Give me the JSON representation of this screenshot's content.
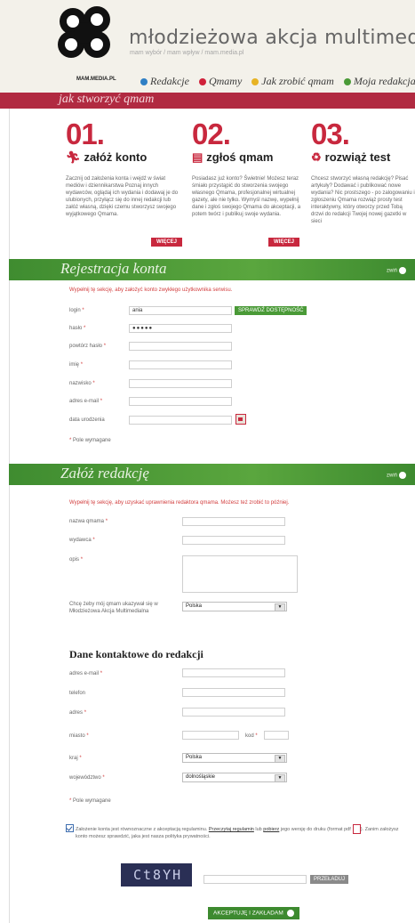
{
  "header": {
    "brand_small": "MAM.MEDIA.PL",
    "site_title": "młodzieżowa akcja multimedialna",
    "tagline": "mam wybór / mam wpływ / mam.media.pl",
    "nav": [
      {
        "label": "Redakcje",
        "color": "#2f7fc5"
      },
      {
        "label": "Qmamy",
        "color": "#d0213a"
      },
      {
        "label": "Jak zrobić qmam",
        "color": "#e7b324"
      },
      {
        "label": "Moja redakcja",
        "color": "#4a9a37"
      }
    ]
  },
  "section_title": "jak stworzyć qmam",
  "steps": [
    {
      "num": "01.",
      "title": "załóż konto",
      "icon": "runner-icon",
      "text": "Zacznij od założenia konta i wejdź w świat mediów i dziennikarstwa Poznaj innych wydawców, oglądaj ich wydania i dodawaj je do ulubionych, przyłącz się do innej redakcji lub załóż własną, dzięki czemu stworzysz swojego wyjątkowego Qmama.",
      "more": "WIĘCEJ"
    },
    {
      "num": "02.",
      "title": "zgłoś qmam",
      "icon": "document-icon",
      "text": "Posiadasz już konto? Świetnie! Możesz teraz śmiało przystąpić do stworzenia swojego własnego Qmama, profesjonalnej wirtualnej gazety, ale nie tylko. Wymyśl nazwę, wypełnij dane i zgłoś swojego Qmama do akceptacji, a potem twórz i publikuj swoje wydania.",
      "more": "WIĘCEJ"
    },
    {
      "num": "03.",
      "title": "rozwiąż test",
      "icon": "recycle-icon",
      "text": "Chcesz stworzyć własną redakcję? Pisać artykuły? Dodawać i publikować nowe wydania? Nic prostszego - po zalogowaniu i zgłoszeniu Qmama rozwiąż prosty test interaktywny, który otworzy przed Tobą drzwi do redakcji Twojej nowej gazetki w sieci",
      "more": ""
    }
  ],
  "registration": {
    "band_title": "Rejestracja konta",
    "collapse": "zwiń",
    "intro": "Wypełnij tę sekcję, aby założyć konto zwykłego użytkownika serwisu.",
    "fields": [
      {
        "label": "login",
        "required": true,
        "value": "ania"
      },
      {
        "label": "hasło",
        "required": true,
        "value": "●●●●●"
      },
      {
        "label": "powtórz hasło",
        "required": true,
        "value": ""
      },
      {
        "label": "imię",
        "required": true,
        "value": ""
      },
      {
        "label": "nazwisko",
        "required": true,
        "value": ""
      },
      {
        "label": "adres e-mail",
        "required": true,
        "value": ""
      },
      {
        "label": "data urodzenia",
        "required": false,
        "value": ""
      }
    ],
    "check_button": "SPRAWDŹ DOSTĘPNOŚĆ",
    "required_note": "Pole wymagane"
  },
  "redakcja": {
    "band_title": "Załóż redakcję",
    "collapse": "zwiń",
    "intro": "Wypełnij tę sekcję, aby uzyskać uprawnienia redaktora qmama. Możesz też zrobić to później.",
    "name_label": "nazwa qmama",
    "publisher_label": "wydawca",
    "desc_label": "opis",
    "country_question": "Chcę żeby mój qmam ukazywał się w Młodzieżowa Akcja Multimedialna",
    "country_value": "Polska",
    "contact_heading": "Dane kontaktowe do redakcji",
    "email_label": "adres e-mail",
    "phone_label": "telefon",
    "address_label": "adres",
    "city_label": "miasto",
    "postcode_label": "kod",
    "country_label": "kraj",
    "country_select": "Polska",
    "region_label": "województwo",
    "region_select": "dolnośląskie",
    "required_note": "Pole wymagane"
  },
  "consent": {
    "text_a": "Założenie konta jest równoznaczne z akceptacją regulaminu.",
    "link1": "Przeczytaj regulamin",
    "text_b": "lub",
    "link2": "pobierz",
    "text_c": "jego wersję do druku (format pdf",
    "text_d": "). Zanim założysz konto możesz sprawdzić, jaka jest nasza polityka prywatności."
  },
  "captcha": {
    "text": "Ct8YH",
    "refresh": "PRZEŁADUJ"
  },
  "submit": "AKCEPTUJĘ I ZAKŁADAM"
}
